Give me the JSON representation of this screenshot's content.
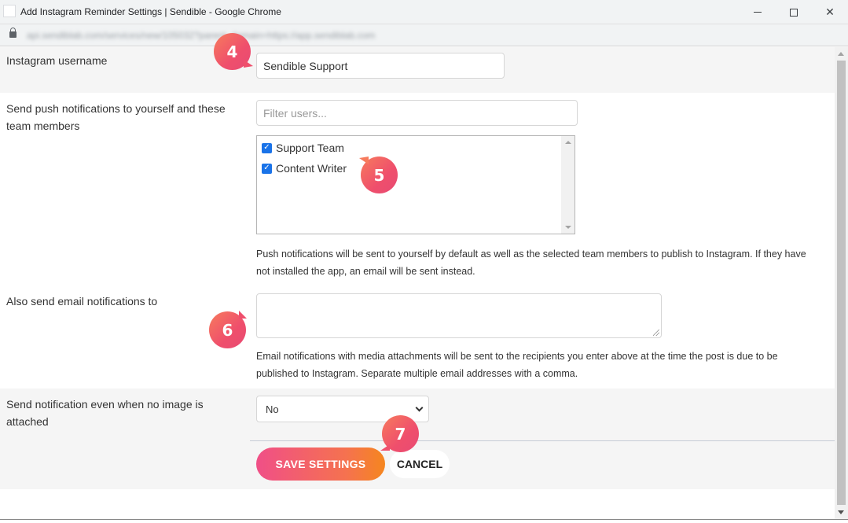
{
  "window": {
    "title": "Add Instagram Reminder Settings | Sendible - Google Chrome",
    "url": "api.sendiblab.com/services/new/105032?parent_domain=https://app.sendiblab.com"
  },
  "form": {
    "instagram_username": {
      "label": "Instagram username",
      "value": "Sendible Support"
    },
    "push_notifications": {
      "label": "Send push notifications to yourself and these team members",
      "filter_placeholder": "Filter users...",
      "members": [
        {
          "name": "Support Team",
          "checked": true
        },
        {
          "name": "Content Writer",
          "checked": true
        }
      ],
      "help": "Push notifications will be sent to yourself by default as well as the selected team members to publish to Instagram. If they have not installed the app, an email will be sent instead."
    },
    "email_notifications": {
      "label": "Also send email notifications to",
      "value": "",
      "help": "Email notifications with media attachments will be sent to the recipients you enter above at the time the post is due to be published to Instagram. Separate multiple email addresses with a comma."
    },
    "no_image": {
      "label": "Send notification even when no image is attached",
      "selected": "No"
    },
    "save_label": "SAVE SETTINGS",
    "cancel_label": "CANCEL"
  },
  "callouts": [
    "4",
    "5",
    "6",
    "7"
  ],
  "colors": {
    "accent_gradient_start": "#f04f87",
    "accent_gradient_end": "#f5861f",
    "checkbox": "#1a73e8",
    "row_background": "#f5f5f5"
  }
}
